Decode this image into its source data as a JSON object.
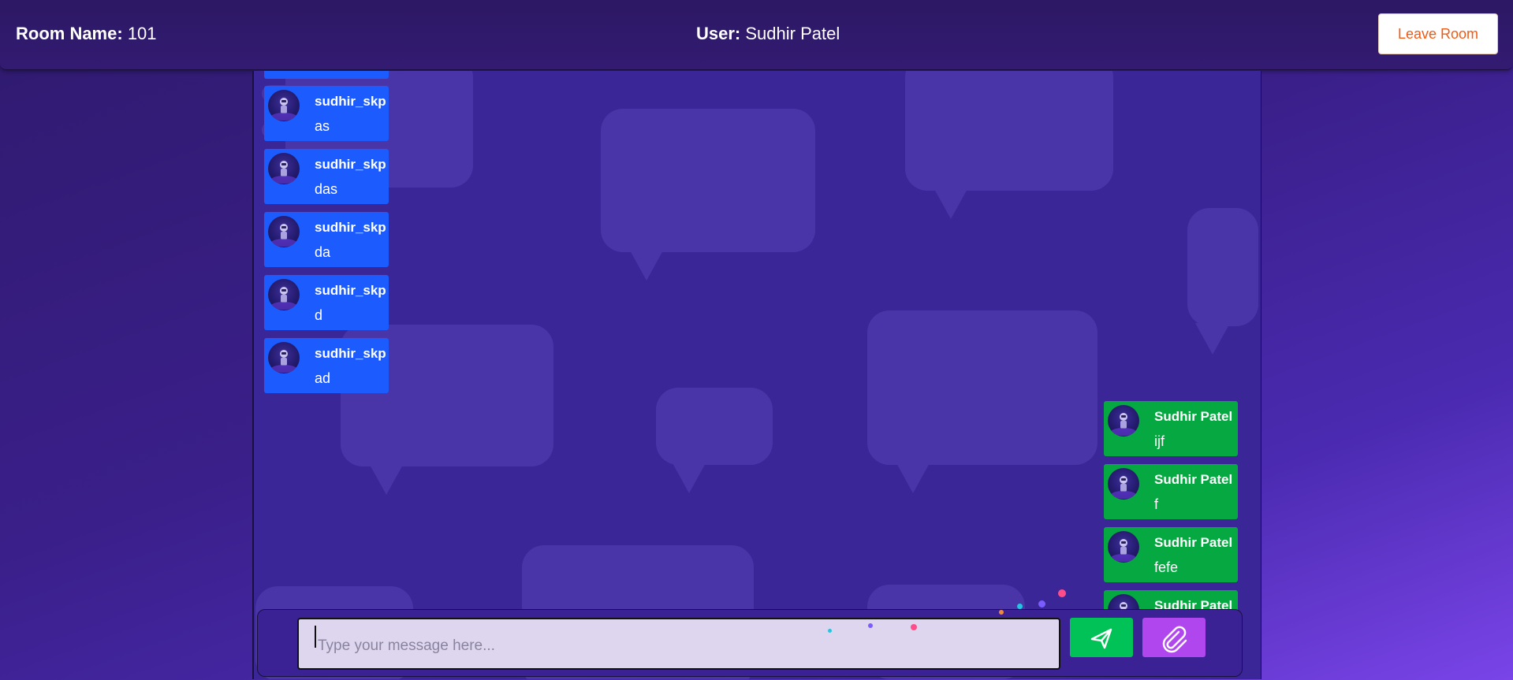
{
  "header": {
    "room_label": "Room Name:",
    "room_value": "101",
    "user_label": "User:",
    "user_value": "Sudhir Patel",
    "leave_button": "Leave Room"
  },
  "messages_other": [
    {
      "sender": "sudhir_skp",
      "text": "as"
    },
    {
      "sender": "sudhir_skp",
      "text": "das"
    },
    {
      "sender": "sudhir_skp",
      "text": "da"
    },
    {
      "sender": "sudhir_skp",
      "text": "d"
    },
    {
      "sender": "sudhir_skp",
      "text": "ad"
    }
  ],
  "messages_self": [
    {
      "sender": "Sudhir Patel",
      "text": "ijf"
    },
    {
      "sender": "Sudhir Patel",
      "text": "f"
    },
    {
      "sender": "Sudhir Patel",
      "text": "fefe"
    },
    {
      "sender": "Sudhir Patel",
      "text": ""
    }
  ],
  "composer": {
    "placeholder": "Type your message here...",
    "value": ""
  },
  "icons": {
    "send": "send-icon",
    "attach": "paperclip-icon",
    "avatar": "astronaut-avatar"
  },
  "colors": {
    "other_bubble": "#1c5cff",
    "self_bubble": "#06a842",
    "leave_text": "#f05a14",
    "send_button": "#00c256",
    "attach_button": "#b046ee"
  }
}
